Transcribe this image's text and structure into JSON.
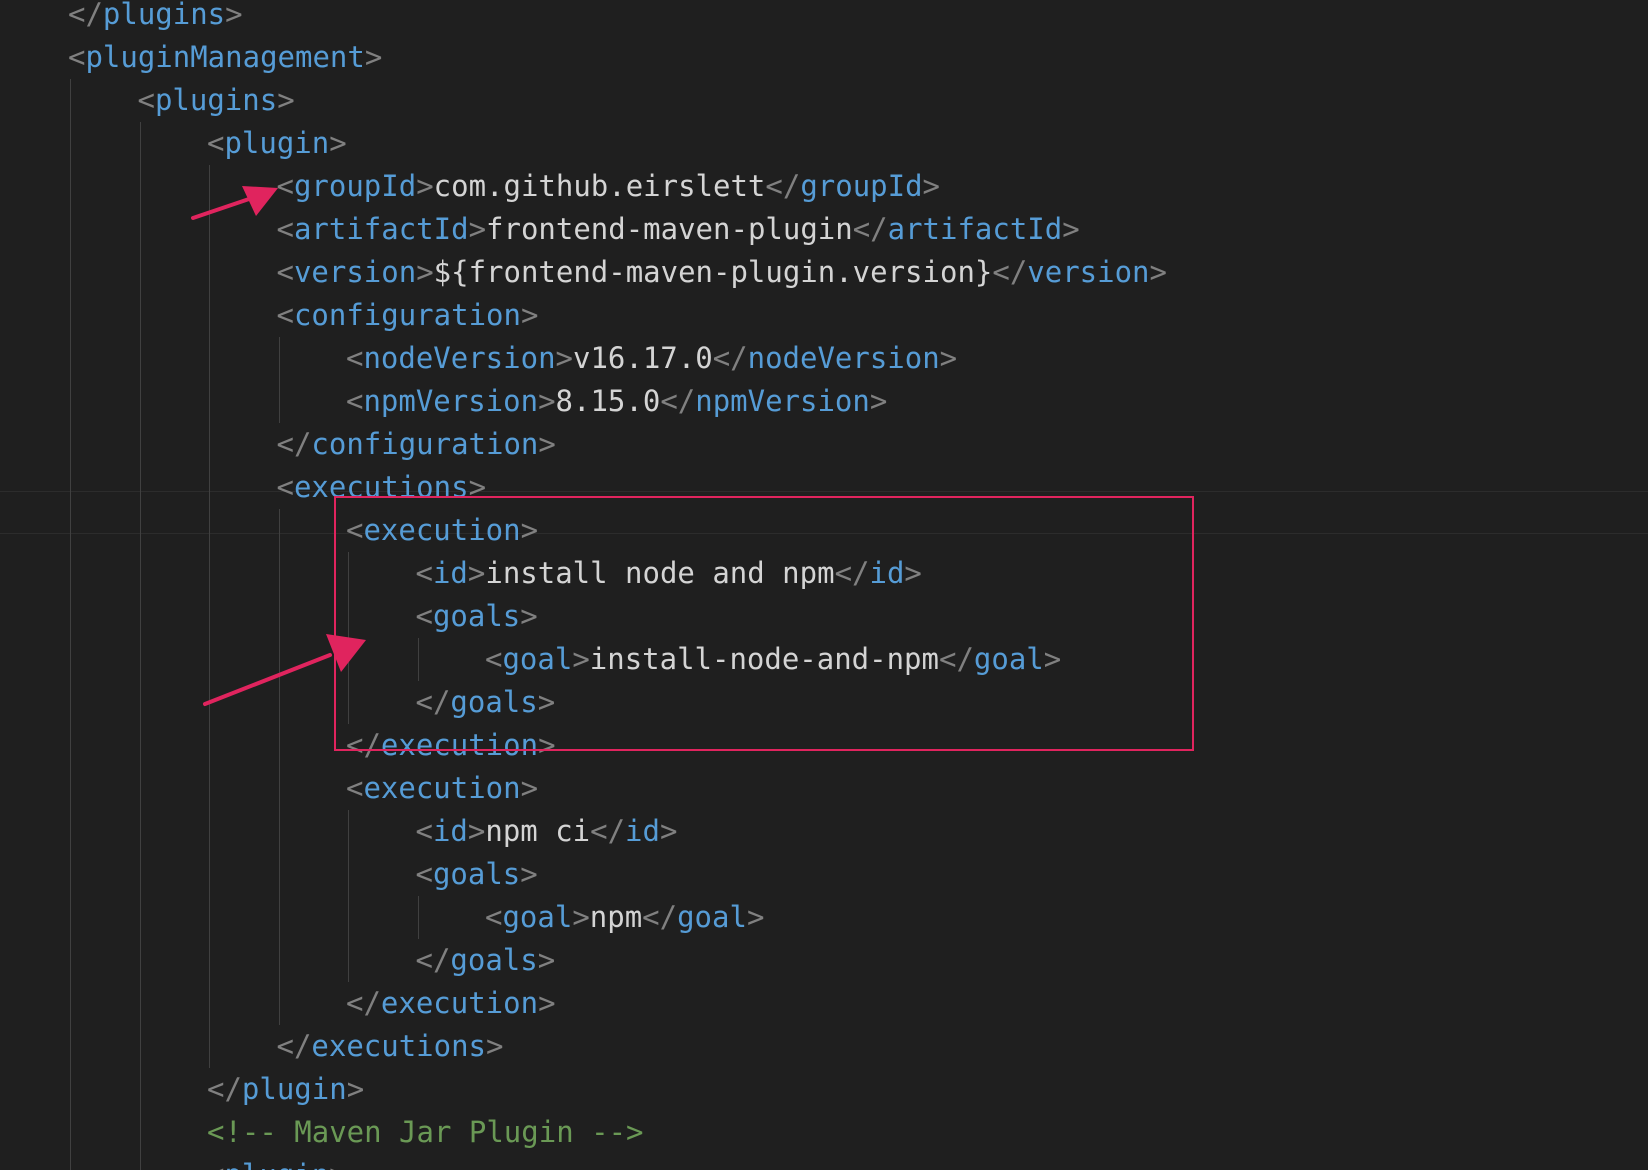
{
  "colors": {
    "background": "#1f1f1f",
    "tag": "#569cd6",
    "bracket": "#808080",
    "text": "#d4d4d4",
    "comment": "#6a9955",
    "annotation": "#e0245e"
  },
  "lines": [
    {
      "indent": 1,
      "tokens": [
        [
          "br",
          "</"
        ],
        [
          "tg",
          "plugins"
        ],
        [
          "br",
          ">"
        ]
      ]
    },
    {
      "indent": 1,
      "tokens": [
        [
          "br",
          "<"
        ],
        [
          "tg",
          "pluginManagement"
        ],
        [
          "br",
          ">"
        ]
      ]
    },
    {
      "indent": 2,
      "tokens": [
        [
          "br",
          "<"
        ],
        [
          "tg",
          "plugins"
        ],
        [
          "br",
          ">"
        ]
      ]
    },
    {
      "indent": 3,
      "tokens": [
        [
          "br",
          "<"
        ],
        [
          "tg",
          "plugin"
        ],
        [
          "br",
          ">"
        ]
      ]
    },
    {
      "indent": 4,
      "tokens": [
        [
          "br",
          "<"
        ],
        [
          "tg",
          "groupId"
        ],
        [
          "br",
          ">"
        ],
        [
          "tx",
          "com.github.eirslett"
        ],
        [
          "br",
          "</"
        ],
        [
          "tg",
          "groupId"
        ],
        [
          "br",
          ">"
        ]
      ]
    },
    {
      "indent": 4,
      "tokens": [
        [
          "br",
          "<"
        ],
        [
          "tg",
          "artifactId"
        ],
        [
          "br",
          ">"
        ],
        [
          "tx",
          "frontend-maven-plugin"
        ],
        [
          "br",
          "</"
        ],
        [
          "tg",
          "artifactId"
        ],
        [
          "br",
          ">"
        ]
      ]
    },
    {
      "indent": 4,
      "tokens": [
        [
          "br",
          "<"
        ],
        [
          "tg",
          "version"
        ],
        [
          "br",
          ">"
        ],
        [
          "tx",
          "${frontend-maven-plugin.version}"
        ],
        [
          "br",
          "</"
        ],
        [
          "tg",
          "version"
        ],
        [
          "br",
          ">"
        ]
      ]
    },
    {
      "indent": 4,
      "tokens": [
        [
          "br",
          "<"
        ],
        [
          "tg",
          "configuration"
        ],
        [
          "br",
          ">"
        ]
      ]
    },
    {
      "indent": 5,
      "tokens": [
        [
          "br",
          "<"
        ],
        [
          "tg",
          "nodeVersion"
        ],
        [
          "br",
          ">"
        ],
        [
          "tx",
          "v16.17.0"
        ],
        [
          "br",
          "</"
        ],
        [
          "tg",
          "nodeVersion"
        ],
        [
          "br",
          ">"
        ]
      ]
    },
    {
      "indent": 5,
      "tokens": [
        [
          "br",
          "<"
        ],
        [
          "tg",
          "npmVersion"
        ],
        [
          "br",
          ">"
        ],
        [
          "tx",
          "8.15.0"
        ],
        [
          "br",
          "</"
        ],
        [
          "tg",
          "npmVersion"
        ],
        [
          "br",
          ">"
        ]
      ]
    },
    {
      "indent": 4,
      "tokens": [
        [
          "br",
          "</"
        ],
        [
          "tg",
          "configuration"
        ],
        [
          "br",
          ">"
        ]
      ]
    },
    {
      "indent": 4,
      "tokens": [
        [
          "br",
          "<"
        ],
        [
          "tg",
          "executions"
        ],
        [
          "br",
          ">"
        ]
      ]
    },
    {
      "indent": 5,
      "tokens": [
        [
          "br",
          "<"
        ],
        [
          "tg",
          "execution"
        ],
        [
          "br",
          ">"
        ]
      ]
    },
    {
      "indent": 6,
      "tokens": [
        [
          "br",
          "<"
        ],
        [
          "tg",
          "id"
        ],
        [
          "br",
          ">"
        ],
        [
          "tx",
          "install node and npm"
        ],
        [
          "br",
          "</"
        ],
        [
          "tg",
          "id"
        ],
        [
          "br",
          ">"
        ]
      ]
    },
    {
      "indent": 6,
      "tokens": [
        [
          "br",
          "<"
        ],
        [
          "tg",
          "goals"
        ],
        [
          "br",
          ">"
        ]
      ]
    },
    {
      "indent": 7,
      "tokens": [
        [
          "br",
          "<"
        ],
        [
          "tg",
          "goal"
        ],
        [
          "br",
          ">"
        ],
        [
          "tx",
          "install-node-and-npm"
        ],
        [
          "br",
          "</"
        ],
        [
          "tg",
          "goal"
        ],
        [
          "br",
          ">"
        ]
      ]
    },
    {
      "indent": 6,
      "tokens": [
        [
          "br",
          "</"
        ],
        [
          "tg",
          "goals"
        ],
        [
          "br",
          ">"
        ]
      ]
    },
    {
      "indent": 5,
      "tokens": [
        [
          "br",
          "</"
        ],
        [
          "tg",
          "execution"
        ],
        [
          "br",
          ">"
        ]
      ]
    },
    {
      "indent": 5,
      "tokens": [
        [
          "br",
          "<"
        ],
        [
          "tg",
          "execution"
        ],
        [
          "br",
          ">"
        ]
      ]
    },
    {
      "indent": 6,
      "tokens": [
        [
          "br",
          "<"
        ],
        [
          "tg",
          "id"
        ],
        [
          "br",
          ">"
        ],
        [
          "tx",
          "npm ci"
        ],
        [
          "br",
          "</"
        ],
        [
          "tg",
          "id"
        ],
        [
          "br",
          ">"
        ]
      ]
    },
    {
      "indent": 6,
      "tokens": [
        [
          "br",
          "<"
        ],
        [
          "tg",
          "goals"
        ],
        [
          "br",
          ">"
        ]
      ]
    },
    {
      "indent": 7,
      "tokens": [
        [
          "br",
          "<"
        ],
        [
          "tg",
          "goal"
        ],
        [
          "br",
          ">"
        ],
        [
          "tx",
          "npm"
        ],
        [
          "br",
          "</"
        ],
        [
          "tg",
          "goal"
        ],
        [
          "br",
          ">"
        ]
      ]
    },
    {
      "indent": 6,
      "tokens": [
        [
          "br",
          "</"
        ],
        [
          "tg",
          "goals"
        ],
        [
          "br",
          ">"
        ]
      ]
    },
    {
      "indent": 5,
      "tokens": [
        [
          "br",
          "</"
        ],
        [
          "tg",
          "execution"
        ],
        [
          "br",
          ">"
        ]
      ]
    },
    {
      "indent": 4,
      "tokens": [
        [
          "br",
          "</"
        ],
        [
          "tg",
          "executions"
        ],
        [
          "br",
          ">"
        ]
      ]
    },
    {
      "indent": 3,
      "tokens": [
        [
          "br",
          "</"
        ],
        [
          "tg",
          "plugin"
        ],
        [
          "br",
          ">"
        ]
      ]
    },
    {
      "indent": 3,
      "tokens": [
        [
          "cm",
          "<!-- Maven Jar Plugin -->"
        ]
      ]
    },
    {
      "indent": 3,
      "tokens": [
        [
          "br",
          "<"
        ],
        [
          "tg",
          "plugin"
        ],
        [
          "br",
          ">"
        ]
      ]
    }
  ]
}
